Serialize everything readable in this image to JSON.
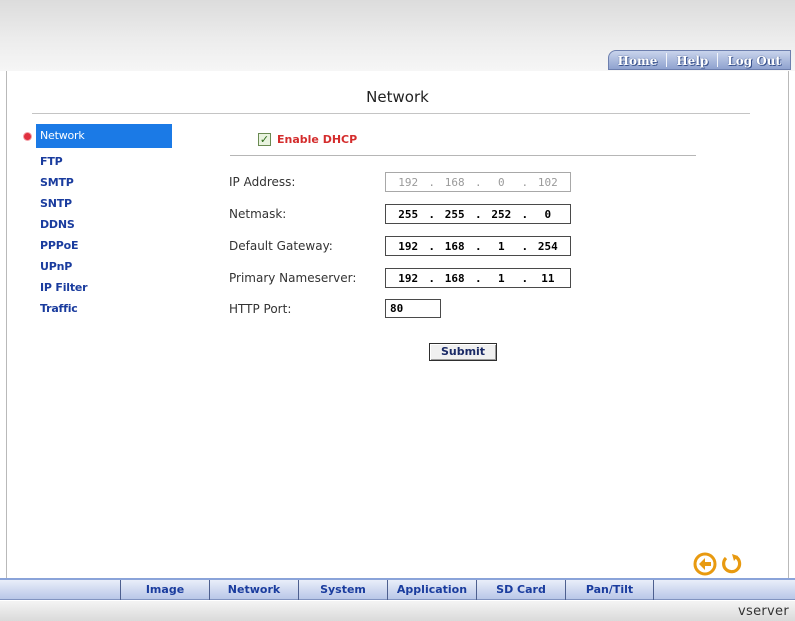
{
  "top_nav": {
    "home": "Home",
    "help": "Help",
    "logout": "Log Out"
  },
  "page": {
    "title": "Network"
  },
  "sidebar": {
    "items": [
      {
        "label": "Network",
        "active": true
      },
      {
        "label": "FTP"
      },
      {
        "label": "SMTP"
      },
      {
        "label": "SNTP"
      },
      {
        "label": "DDNS"
      },
      {
        "label": "PPPoE"
      },
      {
        "label": "UPnP"
      },
      {
        "label": "IP Filter"
      },
      {
        "label": "Traffic"
      }
    ]
  },
  "form": {
    "dhcp_label": "Enable DHCP",
    "dhcp_checked": true,
    "ip_address": {
      "label": "IP Address:",
      "octets": [
        "192",
        "168",
        "0",
        "102"
      ],
      "disabled": true
    },
    "netmask": {
      "label": "Netmask:",
      "octets": [
        "255",
        "255",
        "252",
        "0"
      ]
    },
    "gateway": {
      "label": "Default Gateway:",
      "octets": [
        "192",
        "168",
        "1",
        "254"
      ]
    },
    "nameserver": {
      "label": "Primary Nameserver:",
      "octets": [
        "192",
        "168",
        "1",
        "11"
      ]
    },
    "http_port": {
      "label": "HTTP Port:",
      "value": "80"
    },
    "submit_label": "Submit"
  },
  "bottom_tabs": [
    "Image",
    "Network",
    "System",
    "Application",
    "SD Card",
    "Pan/Tilt"
  ],
  "icons": {
    "back": "back-arrow-icon",
    "refresh": "refresh-icon"
  },
  "brand": "vserver",
  "colors": {
    "accent": "#1b7ae6",
    "link": "#1a3c9e",
    "dhcp_label": "#d42d2d",
    "bullet": "#e0303f",
    "icon": "#e89a10"
  }
}
